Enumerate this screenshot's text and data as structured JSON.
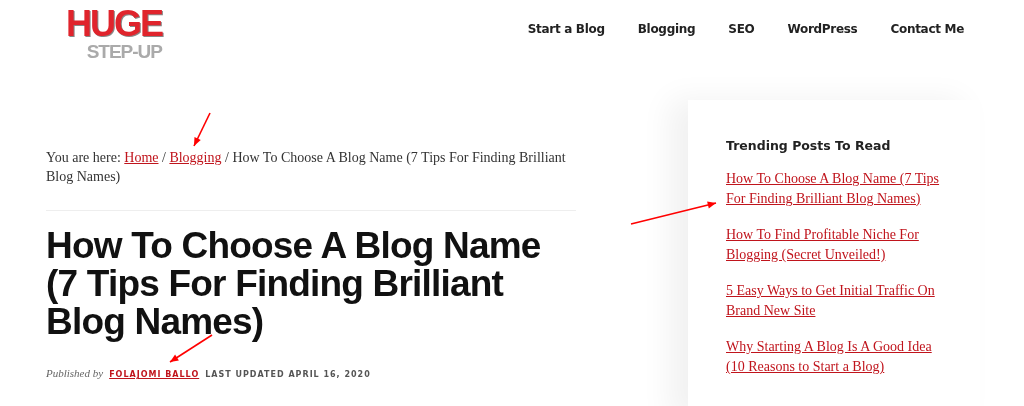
{
  "logo": {
    "top": "HUGE",
    "bottom": "STEP-UP"
  },
  "nav": [
    {
      "label": "Start a Blog"
    },
    {
      "label": "Blogging"
    },
    {
      "label": "SEO"
    },
    {
      "label": "WordPress"
    },
    {
      "label": "Contact Me"
    }
  ],
  "breadcrumb": {
    "prefix": "You are here:",
    "links": [
      "Home",
      "Blogging"
    ],
    "separator": "/",
    "current": "How To Choose A Blog Name (7 Tips For Finding Brilliant Blog Names)"
  },
  "post": {
    "title": "How To Choose A Blog Name (7 Tips For Finding Brilliant Blog Names)",
    "published_by": "Published by",
    "author": "FOLAJOMI BALLO",
    "updated": "LAST UPDATED APRIL 16, 2020"
  },
  "sidebar": {
    "title": "Trending Posts To Read",
    "links": [
      "How To Choose A Blog Name (7 Tips For Finding Brilliant Blog Names)",
      "How To Find Profitable Niche For Blogging (Secret Unveiled!)",
      "5 Easy Ways to Get Initial Traffic On Brand New Site",
      "Why Starting A Blog Is A Good Idea (10 Reasons to Start a Blog)"
    ]
  }
}
